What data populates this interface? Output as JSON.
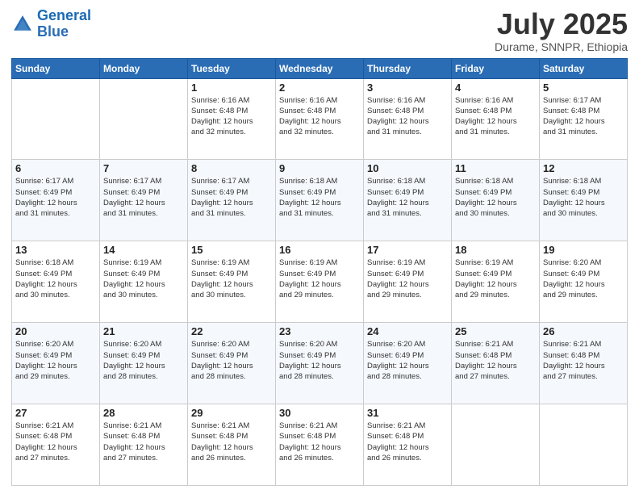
{
  "header": {
    "logo_line1": "General",
    "logo_line2": "Blue",
    "month": "July 2025",
    "location": "Durame, SNNPR, Ethiopia"
  },
  "weekdays": [
    "Sunday",
    "Monday",
    "Tuesday",
    "Wednesday",
    "Thursday",
    "Friday",
    "Saturday"
  ],
  "weeks": [
    [
      {
        "day": "",
        "info": ""
      },
      {
        "day": "",
        "info": ""
      },
      {
        "day": "1",
        "info": "Sunrise: 6:16 AM\nSunset: 6:48 PM\nDaylight: 12 hours\nand 32 minutes."
      },
      {
        "day": "2",
        "info": "Sunrise: 6:16 AM\nSunset: 6:48 PM\nDaylight: 12 hours\nand 32 minutes."
      },
      {
        "day": "3",
        "info": "Sunrise: 6:16 AM\nSunset: 6:48 PM\nDaylight: 12 hours\nand 31 minutes."
      },
      {
        "day": "4",
        "info": "Sunrise: 6:16 AM\nSunset: 6:48 PM\nDaylight: 12 hours\nand 31 minutes."
      },
      {
        "day": "5",
        "info": "Sunrise: 6:17 AM\nSunset: 6:48 PM\nDaylight: 12 hours\nand 31 minutes."
      }
    ],
    [
      {
        "day": "6",
        "info": "Sunrise: 6:17 AM\nSunset: 6:49 PM\nDaylight: 12 hours\nand 31 minutes."
      },
      {
        "day": "7",
        "info": "Sunrise: 6:17 AM\nSunset: 6:49 PM\nDaylight: 12 hours\nand 31 minutes."
      },
      {
        "day": "8",
        "info": "Sunrise: 6:17 AM\nSunset: 6:49 PM\nDaylight: 12 hours\nand 31 minutes."
      },
      {
        "day": "9",
        "info": "Sunrise: 6:18 AM\nSunset: 6:49 PM\nDaylight: 12 hours\nand 31 minutes."
      },
      {
        "day": "10",
        "info": "Sunrise: 6:18 AM\nSunset: 6:49 PM\nDaylight: 12 hours\nand 31 minutes."
      },
      {
        "day": "11",
        "info": "Sunrise: 6:18 AM\nSunset: 6:49 PM\nDaylight: 12 hours\nand 30 minutes."
      },
      {
        "day": "12",
        "info": "Sunrise: 6:18 AM\nSunset: 6:49 PM\nDaylight: 12 hours\nand 30 minutes."
      }
    ],
    [
      {
        "day": "13",
        "info": "Sunrise: 6:18 AM\nSunset: 6:49 PM\nDaylight: 12 hours\nand 30 minutes."
      },
      {
        "day": "14",
        "info": "Sunrise: 6:19 AM\nSunset: 6:49 PM\nDaylight: 12 hours\nand 30 minutes."
      },
      {
        "day": "15",
        "info": "Sunrise: 6:19 AM\nSunset: 6:49 PM\nDaylight: 12 hours\nand 30 minutes."
      },
      {
        "day": "16",
        "info": "Sunrise: 6:19 AM\nSunset: 6:49 PM\nDaylight: 12 hours\nand 29 minutes."
      },
      {
        "day": "17",
        "info": "Sunrise: 6:19 AM\nSunset: 6:49 PM\nDaylight: 12 hours\nand 29 minutes."
      },
      {
        "day": "18",
        "info": "Sunrise: 6:19 AM\nSunset: 6:49 PM\nDaylight: 12 hours\nand 29 minutes."
      },
      {
        "day": "19",
        "info": "Sunrise: 6:20 AM\nSunset: 6:49 PM\nDaylight: 12 hours\nand 29 minutes."
      }
    ],
    [
      {
        "day": "20",
        "info": "Sunrise: 6:20 AM\nSunset: 6:49 PM\nDaylight: 12 hours\nand 29 minutes."
      },
      {
        "day": "21",
        "info": "Sunrise: 6:20 AM\nSunset: 6:49 PM\nDaylight: 12 hours\nand 28 minutes."
      },
      {
        "day": "22",
        "info": "Sunrise: 6:20 AM\nSunset: 6:49 PM\nDaylight: 12 hours\nand 28 minutes."
      },
      {
        "day": "23",
        "info": "Sunrise: 6:20 AM\nSunset: 6:49 PM\nDaylight: 12 hours\nand 28 minutes."
      },
      {
        "day": "24",
        "info": "Sunrise: 6:20 AM\nSunset: 6:49 PM\nDaylight: 12 hours\nand 28 minutes."
      },
      {
        "day": "25",
        "info": "Sunrise: 6:21 AM\nSunset: 6:48 PM\nDaylight: 12 hours\nand 27 minutes."
      },
      {
        "day": "26",
        "info": "Sunrise: 6:21 AM\nSunset: 6:48 PM\nDaylight: 12 hours\nand 27 minutes."
      }
    ],
    [
      {
        "day": "27",
        "info": "Sunrise: 6:21 AM\nSunset: 6:48 PM\nDaylight: 12 hours\nand 27 minutes."
      },
      {
        "day": "28",
        "info": "Sunrise: 6:21 AM\nSunset: 6:48 PM\nDaylight: 12 hours\nand 27 minutes."
      },
      {
        "day": "29",
        "info": "Sunrise: 6:21 AM\nSunset: 6:48 PM\nDaylight: 12 hours\nand 26 minutes."
      },
      {
        "day": "30",
        "info": "Sunrise: 6:21 AM\nSunset: 6:48 PM\nDaylight: 12 hours\nand 26 minutes."
      },
      {
        "day": "31",
        "info": "Sunrise: 6:21 AM\nSunset: 6:48 PM\nDaylight: 12 hours\nand 26 minutes."
      },
      {
        "day": "",
        "info": ""
      },
      {
        "day": "",
        "info": ""
      }
    ]
  ]
}
